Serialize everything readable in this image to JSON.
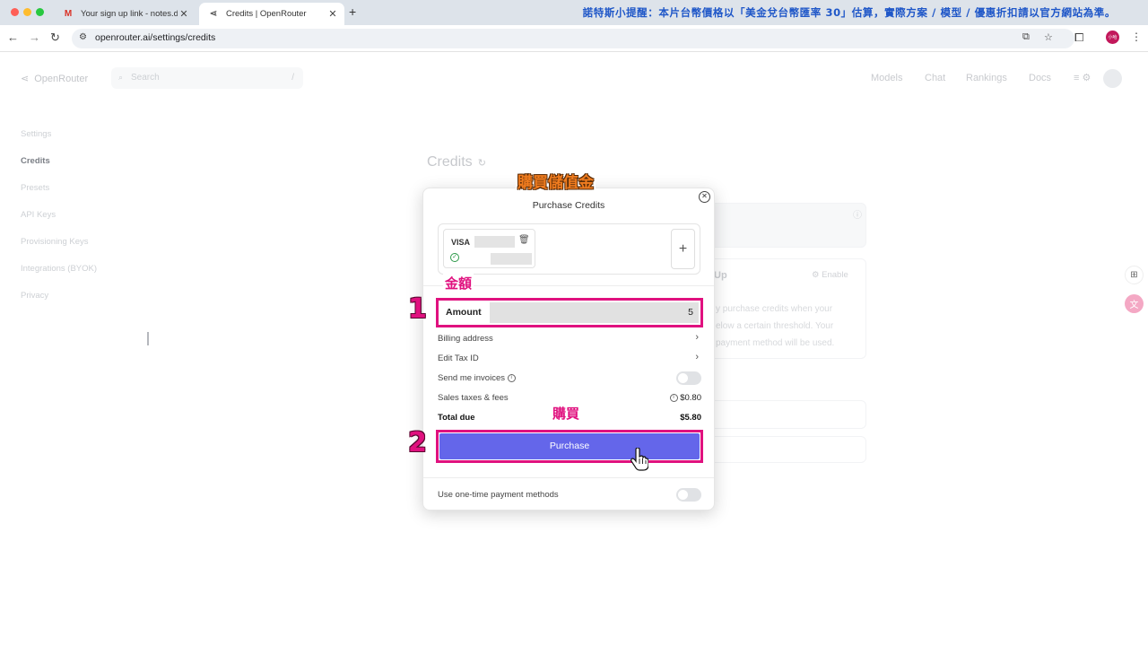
{
  "browser": {
    "tabs": [
      {
        "title": "Your sign up link - notes.dem",
        "icon": "gmail-icon",
        "close": "✕"
      },
      {
        "title": "Credits | OpenRouter",
        "icon": "openrouter-icon",
        "close": "✕"
      }
    ],
    "new_tab": "+",
    "notice": "諾特斯小提醒：本片台幣價格以「美金兌台幣匯率 30」估算，實際方案 / 模型 / 優惠折扣請以官方網站為準。",
    "url": "openrouter.ai/settings/credits",
    "avatar_text": "小哈"
  },
  "site": {
    "logo": "OpenRouter",
    "search_placeholder": "Search",
    "search_shortcut": "/",
    "nav": [
      "Models",
      "Chat",
      "Rankings",
      "Docs"
    ],
    "sidebar": [
      "Settings",
      "Credits",
      "Presets",
      "API Keys",
      "Provisioning Keys",
      "Integrations (BYOK)",
      "Privacy"
    ],
    "page_title": "Credits",
    "bg_topup_title": "Up",
    "bg_enable": "Enable",
    "bg_text": [
      "y purchase credits when your",
      "elow a certain threshold. Your",
      "payment method will be used."
    ]
  },
  "modal": {
    "title": "Purchase Credits",
    "card_brand": "VISA",
    "add_card": "+",
    "amount_label": "Amount",
    "amount_value": "5",
    "billing_address": "Billing address",
    "edit_tax_id": "Edit Tax ID",
    "send_invoices": "Send me invoices",
    "sales_taxes_label": "Sales taxes & fees",
    "sales_taxes_value": "$0.80",
    "total_due_label": "Total due",
    "total_due_value": "$5.80",
    "purchase_label": "Purchase",
    "one_time_label": "Use one-time payment methods",
    "send_invoices_on": false,
    "one_time_on": false
  },
  "annotations": {
    "title": "購買儲值金",
    "amount_tag": "金額",
    "purchase_tag": "購買",
    "step1": "1",
    "step2": "2"
  },
  "colors": {
    "accent": "#6466ea",
    "highlight": "#e0117f",
    "annotation_orange": "#f07c1f"
  }
}
